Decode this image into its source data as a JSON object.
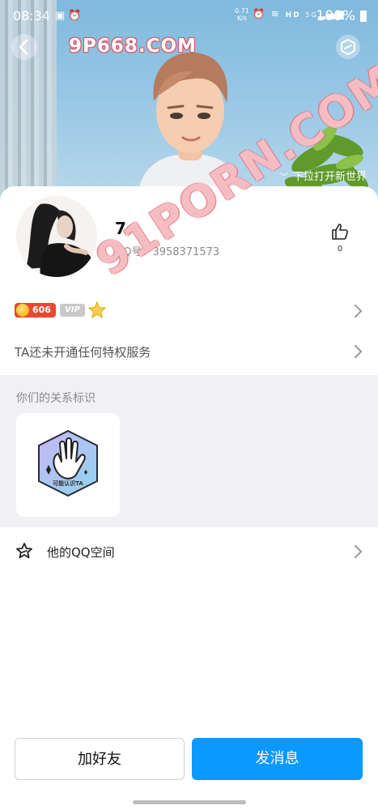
{
  "status_bar": {
    "time": "08:34",
    "net_speed_value": "0.71",
    "net_speed_unit": "K/s",
    "network_label": "HD",
    "generation": "5G",
    "battery": "100%"
  },
  "header": {
    "watermark": "9P668.COM",
    "pull_hint": "下拉打开新世界"
  },
  "profile": {
    "nickname": "7.",
    "qq_label": "QQ号：3958371573",
    "likes": "0",
    "watermark": "91PORN.COM"
  },
  "badges": {
    "coin_value": "606",
    "vip_label": "VIP"
  },
  "privilege": {
    "text": "TA还未开通任何特权服务"
  },
  "relation": {
    "title": "你们的关系标识",
    "badge_label": "可能认识TA"
  },
  "qzone": {
    "label": "他的QQ空间"
  },
  "actions": {
    "add_friend": "加好友",
    "send_message": "发消息"
  },
  "colors": {
    "accent": "#0a99ff",
    "coin_badge": "#e9482f",
    "relation_bg": "#f1f1f5"
  }
}
